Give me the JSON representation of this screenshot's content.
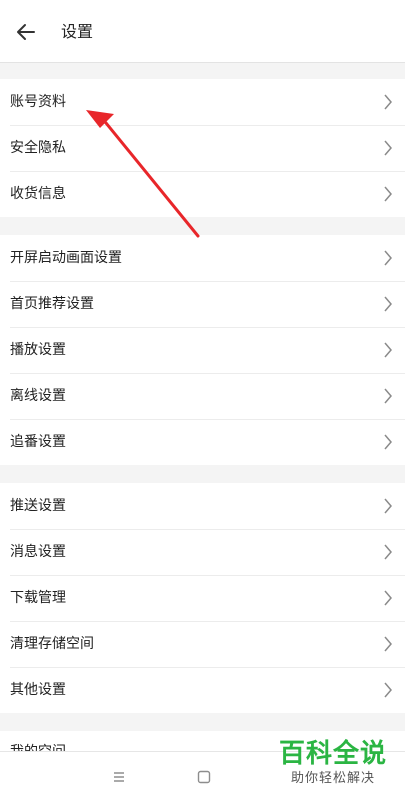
{
  "header": {
    "title": "设置",
    "back_icon": "arrow-left-icon"
  },
  "groups": [
    {
      "items": [
        {
          "label": "账号资料"
        },
        {
          "label": "安全隐私"
        },
        {
          "label": "收货信息"
        }
      ]
    },
    {
      "items": [
        {
          "label": "开屏启动画面设置"
        },
        {
          "label": "首页推荐设置"
        },
        {
          "label": "播放设置"
        },
        {
          "label": "离线设置"
        },
        {
          "label": "追番设置"
        }
      ]
    },
    {
      "items": [
        {
          "label": "推送设置"
        },
        {
          "label": "消息设置"
        },
        {
          "label": "下载管理"
        },
        {
          "label": "清理存储空间"
        },
        {
          "label": "其他设置"
        }
      ]
    },
    {
      "items": [
        {
          "label": "我的空间"
        }
      ]
    }
  ],
  "bottom_nav": {
    "menu_icon": "menu-lines-icon",
    "home_icon": "square-home-icon"
  },
  "watermark": {
    "title": "百科全说",
    "subtitle": "助你轻松解决"
  },
  "annotation": {
    "arrow_color": "#e8262a"
  }
}
